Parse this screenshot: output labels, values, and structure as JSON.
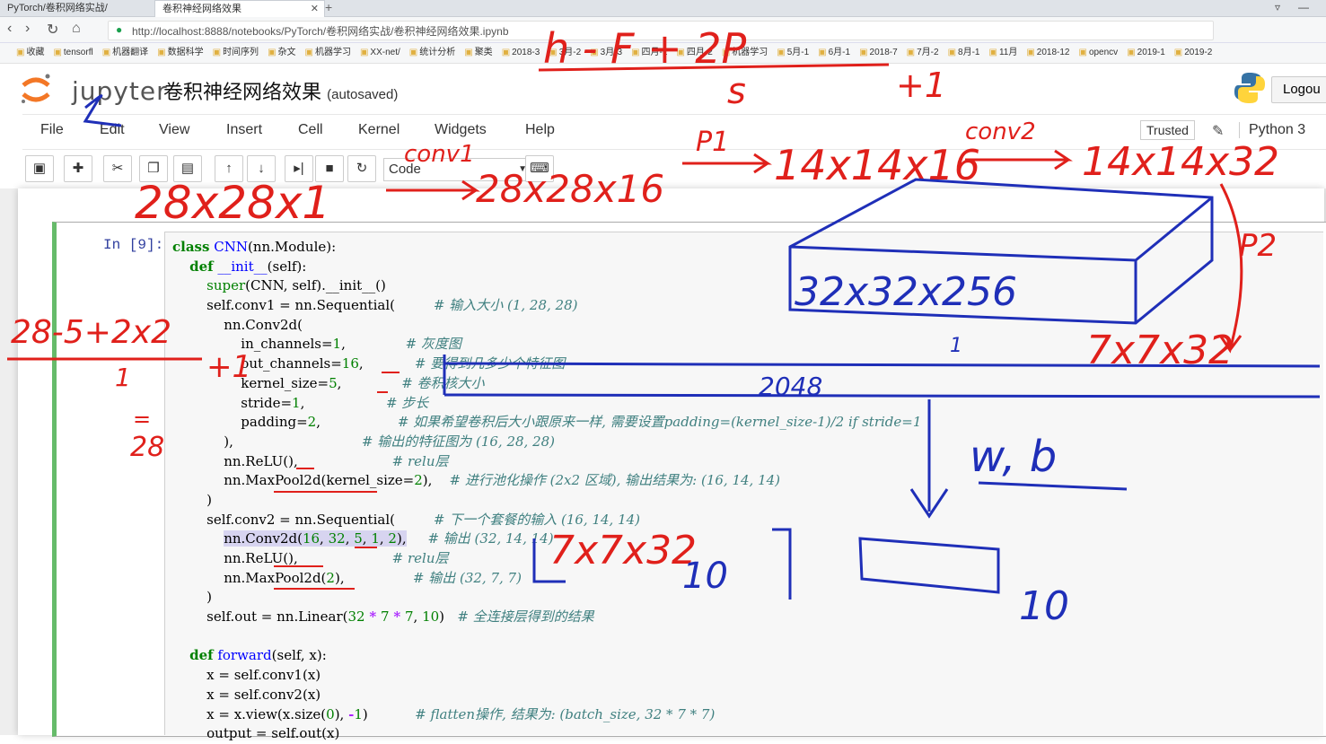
{
  "browser": {
    "tabs": [
      {
        "title": "PyTorch/卷积网络实战/",
        "active": false
      },
      {
        "title": "卷积神经网络效果",
        "active": true
      }
    ],
    "url": "http://localhost:8888/notebooks/PyTorch/卷积网络实战/卷积神经网络效果.ipynb",
    "bookmarks": [
      "收藏",
      "tensorfl",
      "机器翻译",
      "数据科学",
      "时间序列",
      "杂文",
      "机器学习",
      "XX-net/",
      "统计分析",
      "聚类",
      "2018-3",
      "3月-2",
      "3月-3",
      "四月-1",
      "四月-2",
      "机器学习",
      "5月-1",
      "6月-1",
      "2018-7",
      "7月-2",
      "8月-1",
      "11月",
      "2018-12",
      "opencv",
      "2019-1",
      "2019-2"
    ]
  },
  "jupyter": {
    "logo_text": "jupyter",
    "notebook_title": "卷积神经网络效果",
    "autosaved": "(autosaved)",
    "logout": "Logou",
    "menu": [
      "File",
      "Edit",
      "View",
      "Insert",
      "Cell",
      "Kernel",
      "Widgets",
      "Help"
    ],
    "trusted": "Trusted",
    "kernel_name": "Python 3",
    "cell_type": "Code"
  },
  "cell": {
    "prompt": "In [9]:"
  },
  "handwriting": {
    "top_formula_num": "h - F + 2P",
    "top_formula_den": "s",
    "top_formula_plus": "+1",
    "pipeline_start": "28x28x1",
    "conv1": "conv1",
    "after_conv1": "28x28x16",
    "p1": "P1",
    "after_p1": "14x14x16",
    "conv2": "conv2",
    "after_conv2": "14x14x32",
    "p2": "P2",
    "after_p2": "7x7x32",
    "box_label": "32x32x256",
    "one": "1",
    "left_formula_num": "28-5+2x2",
    "left_formula_den": "1",
    "left_formula_plus": "+1",
    "left_formula_eq": "=",
    "left_formula_result": "28",
    "wb": "w, b",
    "fc_in": "7x7x32",
    "fc_out": "10",
    "out_label": "10",
    "scribble": "2048"
  }
}
